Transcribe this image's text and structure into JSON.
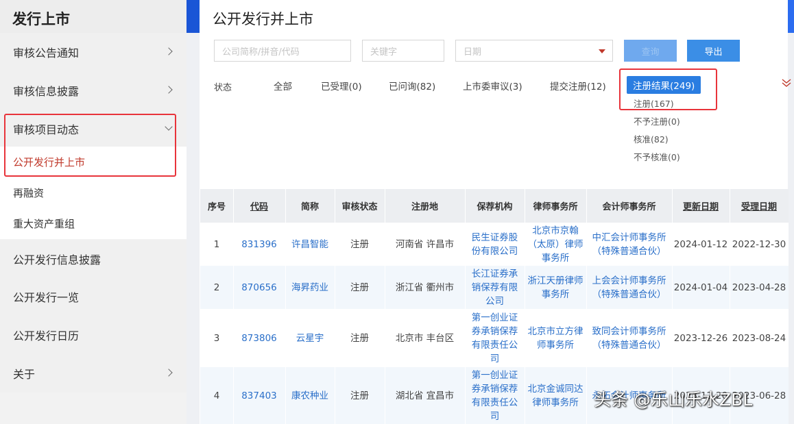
{
  "sidebar": {
    "title": "发行上市",
    "items": [
      {
        "label": "审核公告通知"
      },
      {
        "label": "审核信息披露"
      },
      {
        "label": "审核项目动态"
      },
      {
        "label": "公开发行并上市"
      },
      {
        "label": "再融资"
      },
      {
        "label": "重大资产重组"
      },
      {
        "label": "公开发行信息披露"
      },
      {
        "label": "公开发行一览"
      },
      {
        "label": "公开发行日历"
      },
      {
        "label": "关于"
      }
    ]
  },
  "page": {
    "title": "公开发行并上市"
  },
  "search": {
    "company_placeholder": "公司简称/拼音/代码",
    "keyword_placeholder": "关键字",
    "date_placeholder": "日期",
    "search_label": "查询",
    "export_label": "导出"
  },
  "filters": {
    "status_label": "状态",
    "tabs": [
      "全部",
      "已受理(0)",
      "已问询(82)",
      "上市委审议(3)",
      "提交注册(12)",
      "注册结果(249)"
    ],
    "sub_options": [
      "注册(167)",
      "不予注册(0)",
      "核准(82)",
      "不予核准(0)"
    ]
  },
  "table": {
    "headers": [
      "序号",
      "代码",
      "简称",
      "审核状态",
      "注册地",
      "保荐机构",
      "律师事务所",
      "会计师事务所",
      "更新日期",
      "受理日期"
    ],
    "rows": [
      {
        "no": "1",
        "code": "831396",
        "name": "许昌智能",
        "status": "注册",
        "region": "河南省 许昌市",
        "sponsor": "民生证券股份有限公司",
        "law": "北京市京翰（太原）律师事务所",
        "acct": "中汇会计师事务所（特殊普通合伙）",
        "updated": "2024-01-12",
        "accepted": "2022-12-30"
      },
      {
        "no": "2",
        "code": "870656",
        "name": "海昇药业",
        "status": "注册",
        "region": "浙江省 衢州市",
        "sponsor": "长江证券承销保荐有限公司",
        "law": "浙江天册律师事务所",
        "acct": "上会会计师事务所（特殊普通合伙）",
        "updated": "2024-01-04",
        "accepted": "2023-04-28"
      },
      {
        "no": "3",
        "code": "873806",
        "name": "云星宇",
        "status": "注册",
        "region": "北京市 丰台区",
        "sponsor": "第一创业证券承销保荐有限责任公司",
        "law": "北京市立方律师事务所",
        "acct": "致同会计师事务所（特殊普通合伙）",
        "updated": "2023-12-26",
        "accepted": "2023-08-24"
      },
      {
        "no": "4",
        "code": "837403",
        "name": "康农种业",
        "status": "注册",
        "region": "湖北省 宜昌市",
        "sponsor": "第一创业证券承销保荐有限责任公司",
        "law": "北京金诚同达律师事务所",
        "acct": "永拓会计师事务所",
        "updated": "2023-12-20",
        "accepted": "2023-06-28"
      }
    ]
  },
  "watermark": "头条 @乐山乐水ZBL"
}
